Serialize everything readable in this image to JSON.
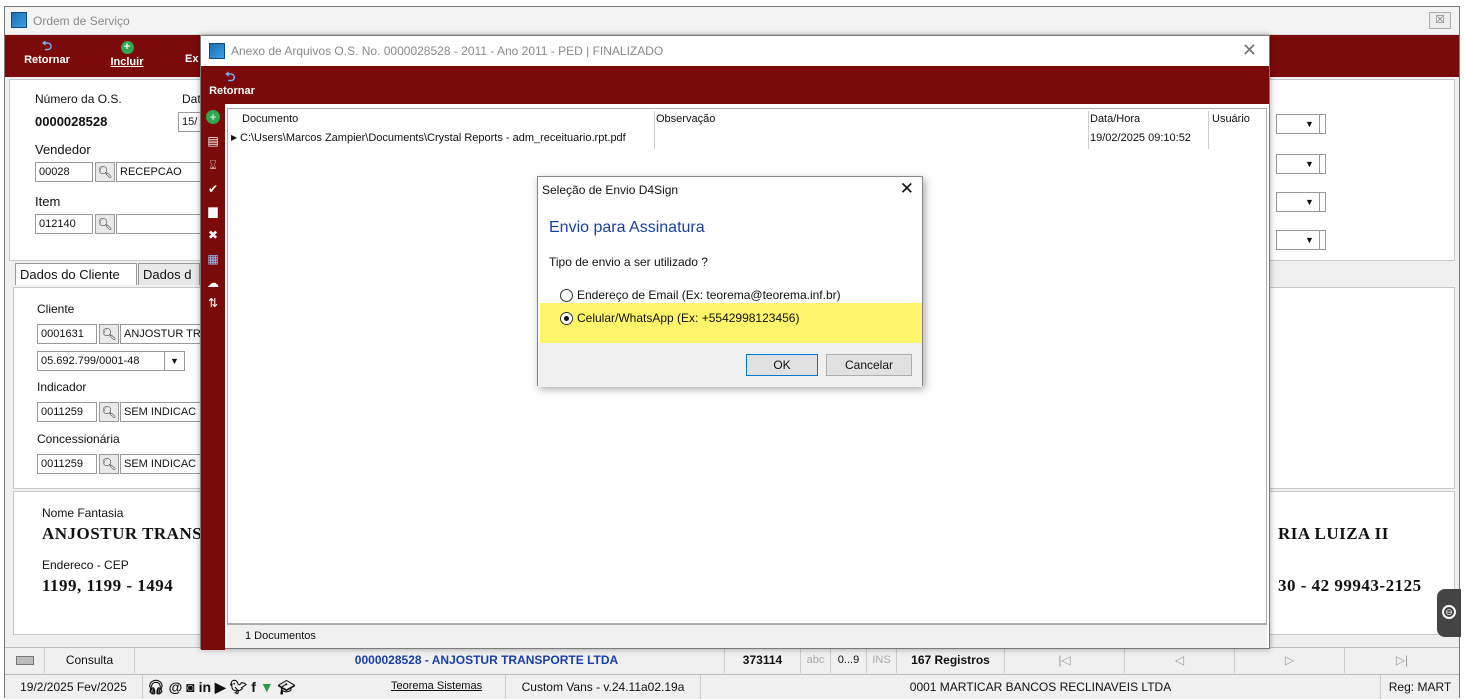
{
  "main_window": {
    "title": "Ordem de Serviço",
    "close_label": "☒",
    "toolbar": {
      "retornar": "Retornar",
      "incluir": "Incluir",
      "partial": "Ex"
    },
    "fields": {
      "numero_label": "Número da O.S.",
      "numero_value": "0000028528",
      "data_label_partial": "Dat",
      "data_value_partial": "15/",
      "vendedor_label": "Vendedor",
      "vendedor_code": "00028",
      "vendedor_name": "RECEPCAO",
      "item_label": "Item",
      "item_code": "012140",
      "item_name": ""
    },
    "tabs": {
      "cliente": "Dados do Cliente",
      "partial": "Dados d"
    },
    "cliente": {
      "cliente_label": "Cliente",
      "cliente_code": "0001631",
      "cliente_name": "ANJOSTUR TRA",
      "cnpj": "05.692.799/0001-48",
      "indicador_label": "Indicador",
      "indicador_code": "0011259",
      "indicador_name": "SEM INDICAC",
      "concessionaria_label": "Concessionária",
      "concessionaria_code": "0011259",
      "concessionaria_name": "SEM INDICAC"
    },
    "info": {
      "nome_fantasia_label": "Nome Fantasia",
      "nome_fantasia_value": "ANJOSTUR TRANSP",
      "right_name": "RIA LUIZA II",
      "endereco_label": "Endereco - CEP",
      "endereco_value": "1199, 1199 - 1494",
      "right_phone": "30 - 42 99943-2125"
    }
  },
  "status_bar": {
    "mode": "Consulta",
    "record": "0000028528 - ANJOSTUR TRANSPORTE LTDA",
    "number": "373114",
    "abc": "abc",
    "digits": "0...9",
    "ins": "INS",
    "registros": "167 Registros",
    "nav_first": "|◁",
    "nav_prev": "◁",
    "nav_next": "▷",
    "nav_last": "▷|"
  },
  "footer_bar": {
    "date": "19/2/2025 Fev/2025",
    "company_link": "Teorema Sistemas",
    "version": "Custom Vans - v.24.11a02.19a",
    "company": "0001 MARTICAR BANCOS RECLINAVEIS LTDA",
    "reg": "Reg: MART",
    "social_icons": [
      "headset-icon",
      "at-icon",
      "instagram-icon",
      "linkedin-icon",
      "youtube-icon",
      "twitter-icon",
      "facebook-icon",
      "filter-icon",
      "graduation-cap-icon"
    ]
  },
  "anexo_window": {
    "title": "Anexo de Arquivos O.S. No. 0000028528 -  2011 - Ano 2011 - PED | FINALIZADO",
    "retornar": "Retornar",
    "columns": [
      "Documento",
      "Observação",
      "Data/Hora",
      "Usuário"
    ],
    "rows": [
      {
        "documento": "C:\\Users\\Marcos Zampier\\Documents\\Crystal Reports - adm_receituario.rpt.pdf",
        "observacao": "",
        "data_hora": "19/02/2025 09:10:52",
        "usuario": ""
      }
    ],
    "footer": "1 Documentos"
  },
  "dialog": {
    "title": "Seleção de Envio D4Sign",
    "heading": "Envio para Assinatura",
    "question": "Tipo de envio a ser utilizado ?",
    "option_email": "Endereço de Email (Ex: teorema@teorema.inf.br)",
    "option_whatsapp": "Celular/WhatsApp (Ex: +5542998123456)",
    "selected": "whatsapp",
    "ok": "OK",
    "cancel": "Cancelar",
    "highlight_color": "#fff56b"
  },
  "colors": {
    "toolbar_red": "#7b0a0a",
    "accent_blue": "#1a3fa8"
  }
}
